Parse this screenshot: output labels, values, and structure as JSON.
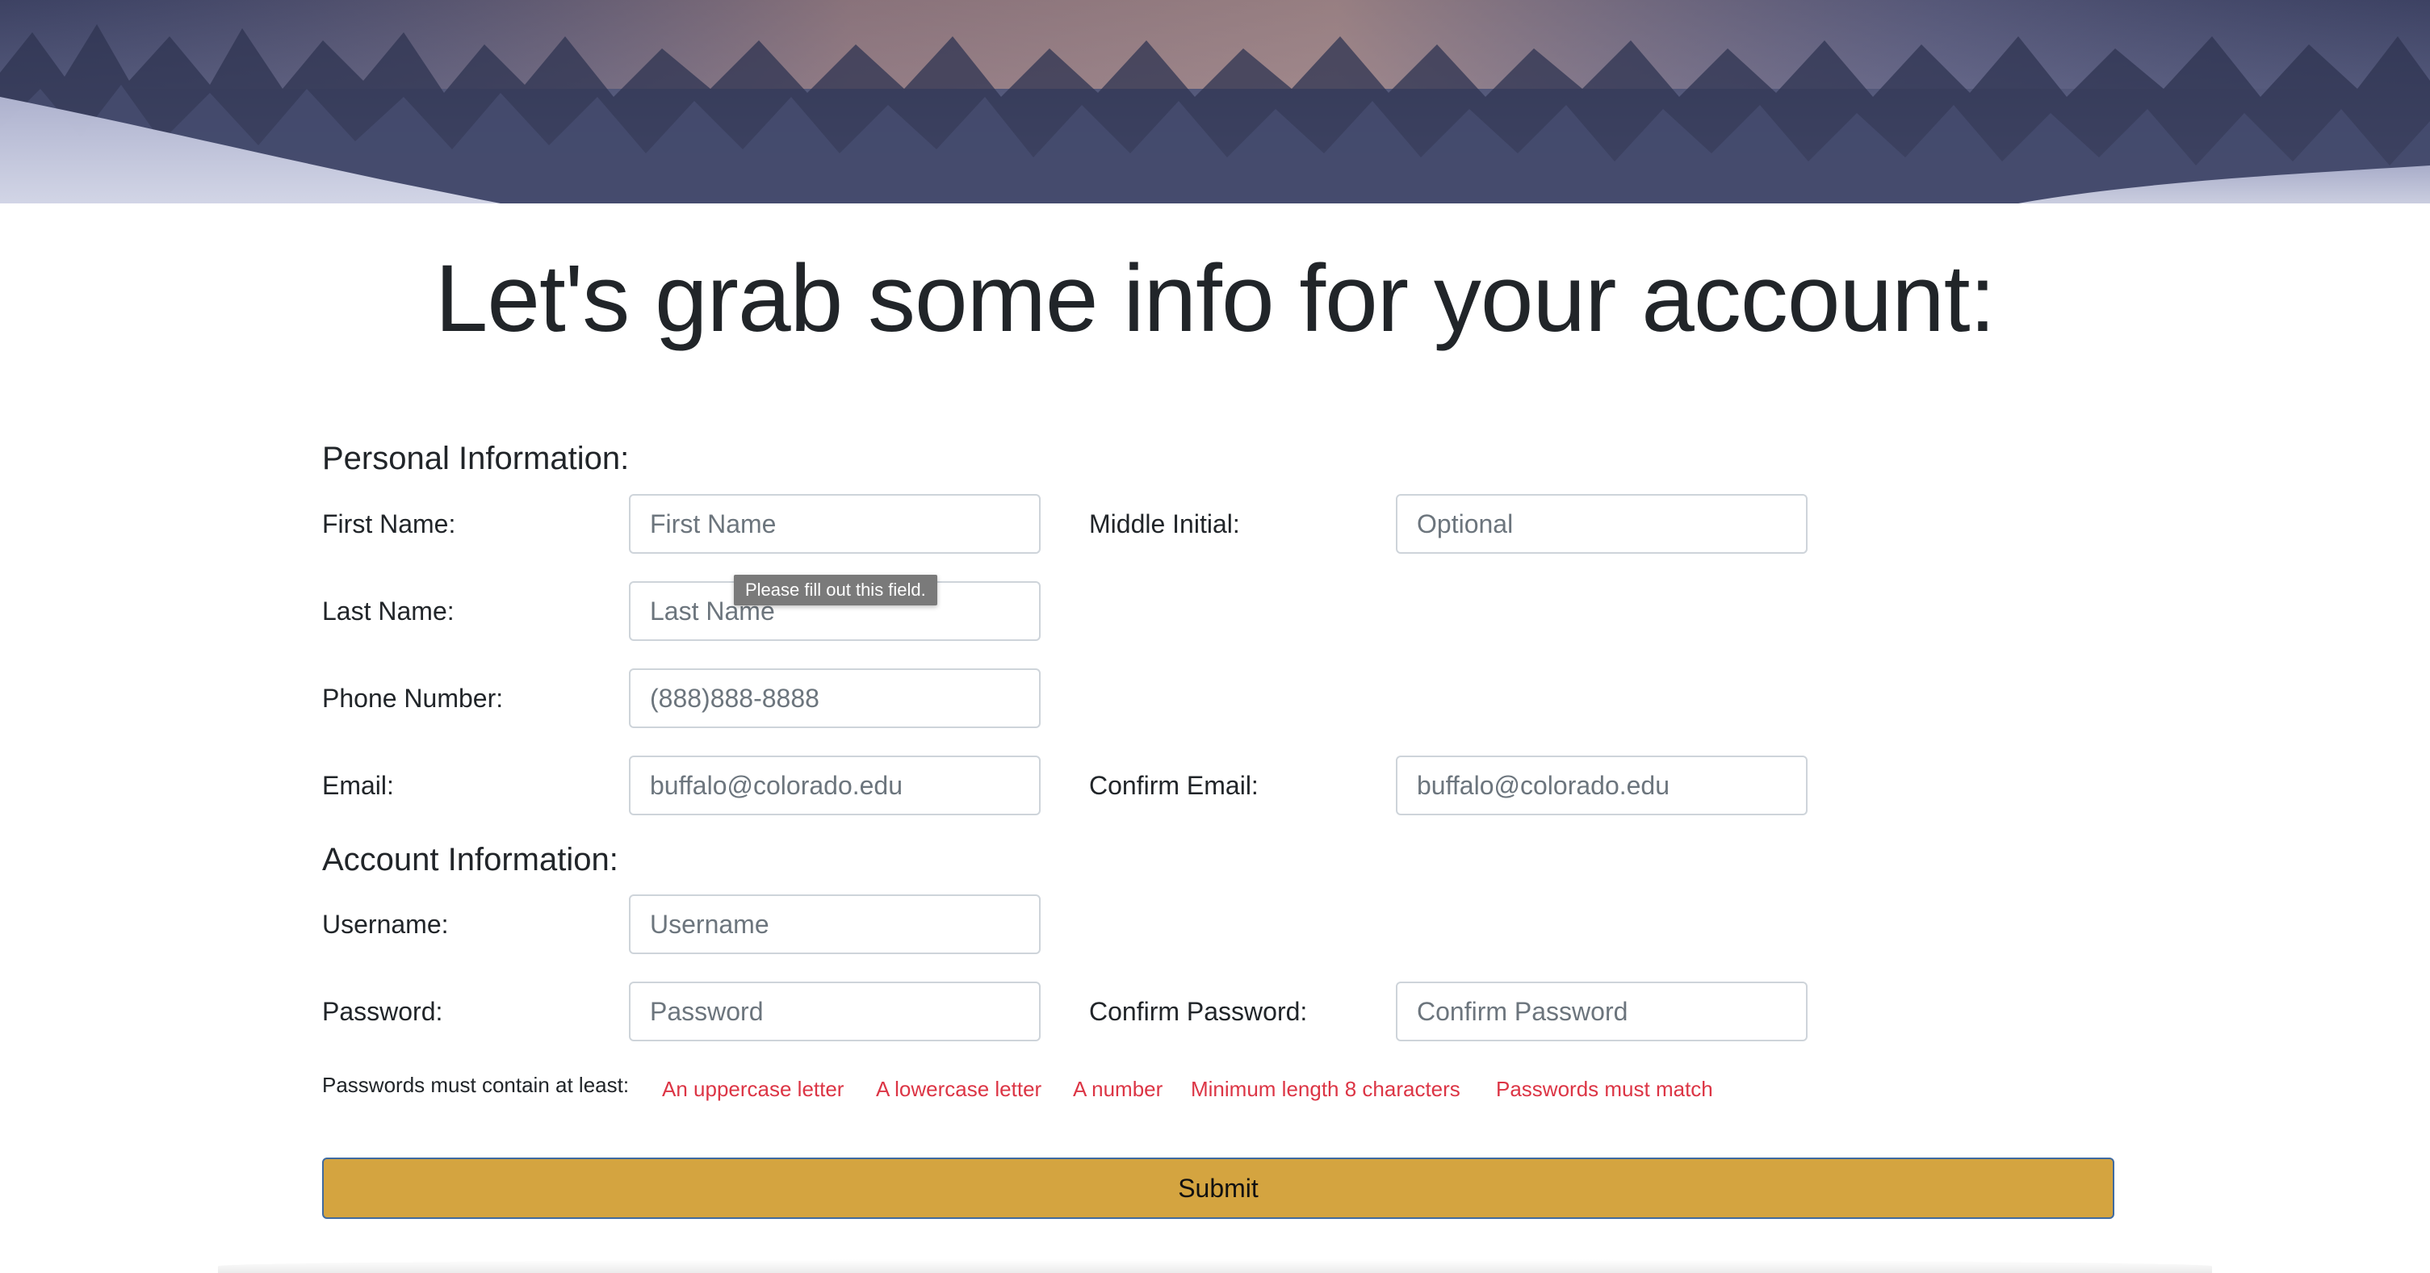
{
  "heading": "Let's grab some info for your account:",
  "personal": {
    "title": "Personal Information:",
    "first_name": {
      "label": "First Name:",
      "placeholder": "First Name",
      "value": ""
    },
    "middle_initial": {
      "label": "Middle Initial:",
      "placeholder": "Optional",
      "value": ""
    },
    "last_name": {
      "label": "Last Name:",
      "placeholder": "Last Name",
      "value": ""
    },
    "phone": {
      "label": "Phone Number:",
      "placeholder": "(888)888-8888",
      "value": ""
    },
    "email": {
      "label": "Email:",
      "placeholder": "buffalo@colorado.edu",
      "value": ""
    },
    "confirm_email": {
      "label": "Confirm Email:",
      "placeholder": "buffalo@colorado.edu",
      "value": ""
    }
  },
  "validation_tooltip": "Please fill out this field.",
  "account": {
    "title": "Account Information:",
    "username": {
      "label": "Username:",
      "placeholder": "Username",
      "value": ""
    },
    "password": {
      "label": "Password:",
      "placeholder": "Password",
      "value": ""
    },
    "confirm_password": {
      "label": "Confirm Password:",
      "placeholder": "Confirm Password",
      "value": ""
    }
  },
  "password_rules": {
    "intro": "Passwords must contain at least:",
    "rules": [
      "An uppercase letter",
      "A lowercase letter",
      "A number",
      "Minimum length 8 characters",
      "Passwords must match"
    ]
  },
  "submit_label": "Submit",
  "colors": {
    "submit_bg": "#d4a440",
    "rule_error": "#dc3545"
  },
  "banner": {
    "icon": "snowy-forest-image"
  }
}
